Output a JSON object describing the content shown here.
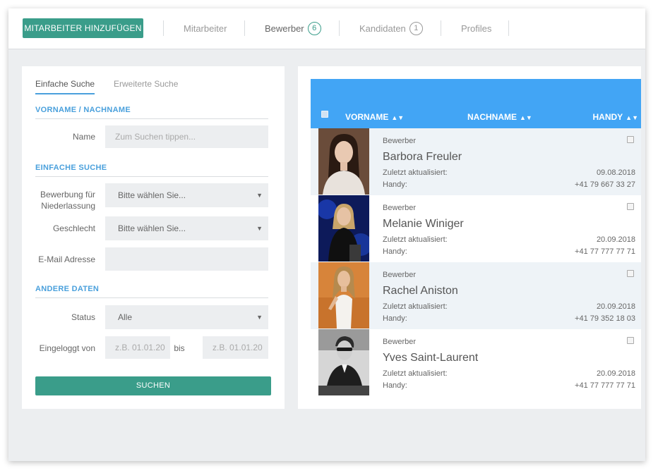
{
  "toolbar": {
    "add_button": "MITARBEITER HINZUFÜGEN",
    "tabs": [
      {
        "label": "Mitarbeiter",
        "count": null
      },
      {
        "label": "Bewerber",
        "count": "6"
      },
      {
        "label": "Kandidaten",
        "count": "1"
      },
      {
        "label": "Profiles",
        "count": null
      }
    ]
  },
  "search": {
    "tabs": [
      "Einfache Suche",
      "Erweiterte Suche"
    ],
    "section_name": "VORNAME / NACHNAME",
    "name_label": "Name",
    "name_placeholder": "Zum Suchen tippen...",
    "section_simple": "EINFACHE SUCHE",
    "branch_label": "Bewerbung für Niederlassung",
    "branch_value": "Bitte wählen Sie...",
    "gender_label": "Geschlecht",
    "gender_value": "Bitte wählen Sie...",
    "email_label": "E-Mail Adresse",
    "email_value": "",
    "section_other": "ANDERE DATEN",
    "status_label": "Status",
    "status_value": "Alle",
    "login_label": "Eingeloggt von",
    "from_placeholder": "z.B. 01.01.20",
    "to_label": "bis",
    "to_placeholder": "z.B. 01.01.20",
    "submit": "SUCHEN"
  },
  "table": {
    "headers": {
      "first": "VORNAME",
      "last": "NACHNAME",
      "phone": "HANDY"
    },
    "rows": [
      {
        "type": "Bewerber",
        "name": "Barbora Freuler",
        "updated_label": "Zuletzt aktualisiert:",
        "updated": "09.08.2018",
        "phone_label": "Handy:",
        "phone": "+41 79 667 33 27"
      },
      {
        "type": "Bewerber",
        "name": "Melanie Winiger",
        "updated_label": "Zuletzt aktualisiert:",
        "updated": "20.09.2018",
        "phone_label": "Handy:",
        "phone": "+41 77 777 77 71"
      },
      {
        "type": "Bewerber",
        "name": "Rachel Aniston",
        "updated_label": "Zuletzt aktualisiert:",
        "updated": "20.09.2018",
        "phone_label": "Handy:",
        "phone": "+41 79 352 18 03"
      },
      {
        "type": "Bewerber",
        "name": "Yves Saint-Laurent",
        "updated_label": "Zuletzt aktualisiert:",
        "updated": "20.09.2018",
        "phone_label": "Handy:",
        "phone": "+41 77 777 77 71"
      }
    ]
  },
  "colors": {
    "accent": "#3a9d8a",
    "header_blue": "#42a5f5",
    "section_blue": "#4aa0dc"
  }
}
